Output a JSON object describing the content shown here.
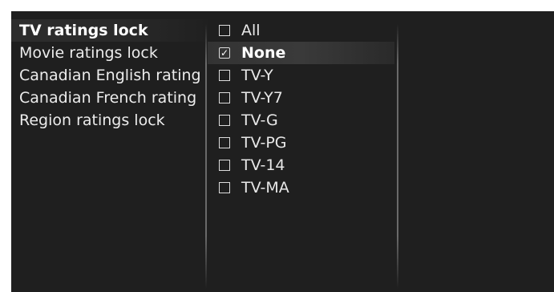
{
  "menu": {
    "items": [
      {
        "label": "TV ratings lock",
        "selected": true
      },
      {
        "label": "Movie ratings lock",
        "selected": false
      },
      {
        "label": "Canadian English rating",
        "selected": false
      },
      {
        "label": "Canadian French rating",
        "selected": false
      },
      {
        "label": "Region ratings lock",
        "selected": false
      }
    ]
  },
  "ratings": {
    "items": [
      {
        "label": "All",
        "checked": false,
        "highlighted": false
      },
      {
        "label": "None",
        "checked": true,
        "highlighted": true
      },
      {
        "label": "TV-Y",
        "checked": false,
        "highlighted": false
      },
      {
        "label": "TV-Y7",
        "checked": false,
        "highlighted": false
      },
      {
        "label": "TV-G",
        "checked": false,
        "highlighted": false
      },
      {
        "label": "TV-PG",
        "checked": false,
        "highlighted": false
      },
      {
        "label": "TV-14",
        "checked": false,
        "highlighted": false
      },
      {
        "label": "TV-MA",
        "checked": false,
        "highlighted": false
      }
    ],
    "check_glyph": "✓"
  },
  "colors": {
    "background": "#1f1f1f",
    "text": "#ececec",
    "highlight": "#3a3a3a"
  }
}
